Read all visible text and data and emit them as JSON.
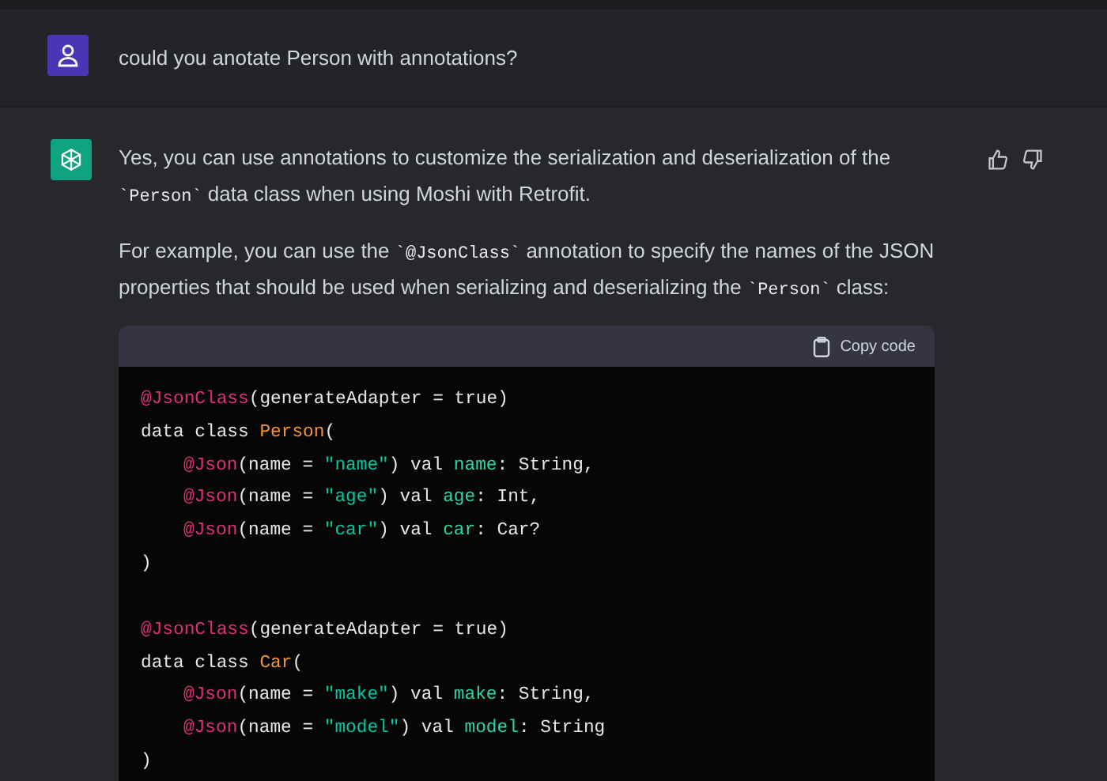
{
  "messages": [
    {
      "kind": "user",
      "paragraphs": [
        [
          {
            "kind": "text",
            "text": "could you anotate Person with annotations?"
          }
        ]
      ]
    },
    {
      "kind": "assistant",
      "paragraphs": [
        [
          {
            "kind": "text",
            "text": "Yes, you can use annotations to customize the serialization and deserialization of the "
          },
          {
            "kind": "code",
            "text": "`Person`"
          },
          {
            "kind": "text",
            "text": " data class when using Moshi with Retrofit."
          }
        ],
        [
          {
            "kind": "text",
            "text": "For example, you can use the "
          },
          {
            "kind": "code",
            "text": "`@JsonClass`"
          },
          {
            "kind": "text",
            "text": " annotation to specify the names of the JSON properties that should be used when serializing and deserializing the "
          },
          {
            "kind": "code",
            "text": "`Person`"
          },
          {
            "kind": "text",
            "text": " class:"
          }
        ]
      ],
      "code_block": {
        "copy_label": "Copy code",
        "blocks": [
          [
            {
              "indent": false,
              "tokens": [
                {
                  "kind": "annotation",
                  "text": "@JsonClass"
                },
                {
                  "kind": "plain",
                  "text": "(generateAdapter = true)"
                }
              ]
            },
            {
              "indent": false,
              "tokens": [
                {
                  "kind": "plain",
                  "text": "data class "
                },
                {
                  "kind": "type",
                  "text": "Person"
                },
                {
                  "kind": "plain",
                  "text": "("
                }
              ]
            },
            {
              "indent": true,
              "tokens": [
                {
                  "kind": "annotation",
                  "text": "@Json"
                },
                {
                  "kind": "plain",
                  "text": "(name = "
                },
                {
                  "kind": "string",
                  "text": "\"name\""
                },
                {
                  "kind": "plain",
                  "text": ") val "
                },
                {
                  "kind": "property",
                  "text": "name"
                },
                {
                  "kind": "plain",
                  "text": ": String,"
                }
              ]
            },
            {
              "indent": true,
              "tokens": [
                {
                  "kind": "annotation",
                  "text": "@Json"
                },
                {
                  "kind": "plain",
                  "text": "(name = "
                },
                {
                  "kind": "string",
                  "text": "\"age\""
                },
                {
                  "kind": "plain",
                  "text": ") val "
                },
                {
                  "kind": "property",
                  "text": "age"
                },
                {
                  "kind": "plain",
                  "text": ": Int,"
                }
              ]
            },
            {
              "indent": true,
              "tokens": [
                {
                  "kind": "annotation",
                  "text": "@Json"
                },
                {
                  "kind": "plain",
                  "text": "(name = "
                },
                {
                  "kind": "string",
                  "text": "\"car\""
                },
                {
                  "kind": "plain",
                  "text": ") val "
                },
                {
                  "kind": "property",
                  "text": "car"
                },
                {
                  "kind": "plain",
                  "text": ": Car?"
                }
              ]
            },
            {
              "indent": false,
              "tokens": [
                {
                  "kind": "plain",
                  "text": ")"
                }
              ]
            }
          ],
          [
            {
              "indent": false,
              "tokens": [
                {
                  "kind": "annotation",
                  "text": "@JsonClass"
                },
                {
                  "kind": "plain",
                  "text": "(generateAdapter = true)"
                }
              ]
            },
            {
              "indent": false,
              "tokens": [
                {
                  "kind": "plain",
                  "text": "data class "
                },
                {
                  "kind": "type",
                  "text": "Car"
                },
                {
                  "kind": "plain",
                  "text": "("
                }
              ]
            },
            {
              "indent": true,
              "tokens": [
                {
                  "kind": "annotation",
                  "text": "@Json"
                },
                {
                  "kind": "plain",
                  "text": "(name = "
                },
                {
                  "kind": "string",
                  "text": "\"make\""
                },
                {
                  "kind": "plain",
                  "text": ") val "
                },
                {
                  "kind": "property",
                  "text": "make"
                },
                {
                  "kind": "plain",
                  "text": ": String,"
                }
              ]
            },
            {
              "indent": true,
              "tokens": [
                {
                  "kind": "annotation",
                  "text": "@Json"
                },
                {
                  "kind": "plain",
                  "text": "(name = "
                },
                {
                  "kind": "string",
                  "text": "\"model\""
                },
                {
                  "kind": "plain",
                  "text": ") val "
                },
                {
                  "kind": "property",
                  "text": "model"
                },
                {
                  "kind": "plain",
                  "text": ": String"
                }
              ]
            },
            {
              "indent": false,
              "tokens": [
                {
                  "kind": "plain",
                  "text": ")"
                }
              ]
            }
          ]
        ]
      }
    }
  ]
}
